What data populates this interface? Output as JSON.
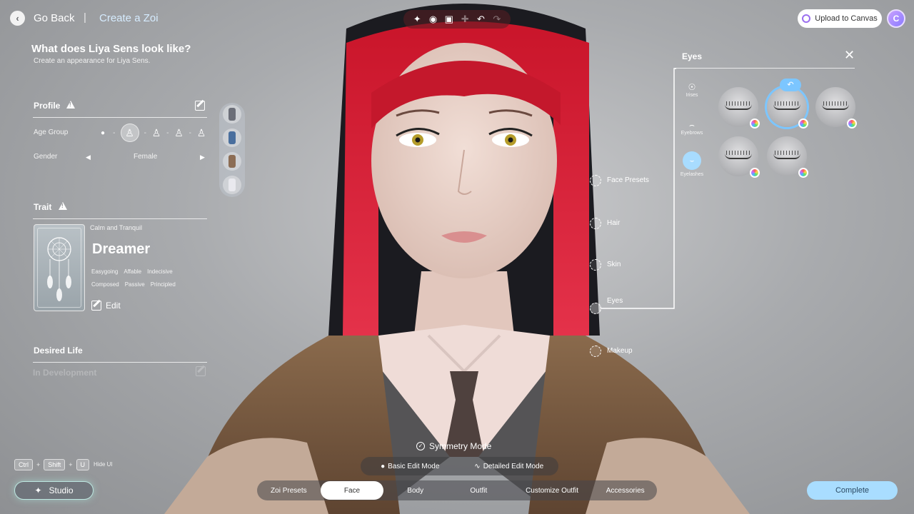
{
  "header": {
    "back_label": "Go Back",
    "separator": "|",
    "crumb": "Create a Zoi",
    "toolbar_icons": [
      "sparkle-icon",
      "camera-icon",
      "focus-icon",
      "pose-icon",
      "undo-icon",
      "redo-icon"
    ],
    "upload_label": "Upload to Canvas",
    "avatar_letter": "C"
  },
  "intro": {
    "title": "What does Liya Sens look like?",
    "subtitle": "Create an appearance for Liya Sens."
  },
  "profile": {
    "heading": "Profile",
    "age_label": "Age Group",
    "gender_label": "Gender",
    "gender_value": "Female",
    "age_selected_index": 1
  },
  "trait": {
    "heading": "Trait",
    "category": "Calm and Tranquil",
    "name": "Dreamer",
    "tags_row1": [
      "Easygoing",
      "Affable",
      "Indecisive"
    ],
    "tags_row2": [
      "Composed",
      "Passive",
      "Principled"
    ],
    "edit_label": "Edit"
  },
  "desired_life": {
    "heading": "Desired Life",
    "status": "In Development"
  },
  "hotkeys": {
    "keys": [
      "Ctrl",
      "Shift",
      "U"
    ],
    "plus": "+",
    "hint": "Hide UI",
    "studio_label": "Studio"
  },
  "regions": {
    "face_presets": "Face Presets",
    "hair": "Hair",
    "skin": "Skin",
    "eyes": "Eyes",
    "makeup": "Makeup"
  },
  "eyes_panel": {
    "title": "Eyes",
    "categories": [
      {
        "label": "Irises",
        "icon": "iris-icon"
      },
      {
        "label": "Eyebrows",
        "icon": "eyebrow-icon"
      },
      {
        "label": "Eyelashes",
        "icon": "eyelash-icon"
      }
    ],
    "selected_category": "Eyelashes",
    "swatch_count": 5,
    "selected_swatch": 2
  },
  "bottom": {
    "symmetry": "Symmetry Mode",
    "basic_mode": "Basic Edit Mode",
    "detailed_mode": "Detailed Edit Mode",
    "tabs": [
      "Zoi Presets",
      "Face",
      "Body",
      "Outfit",
      "Customize Outfit",
      "Accessories"
    ],
    "active_tab": "Face",
    "complete": "Complete"
  },
  "colors": {
    "accent": "#a9ddff",
    "selection_ring": "#7cc6ff",
    "hair": "#d4262e"
  }
}
